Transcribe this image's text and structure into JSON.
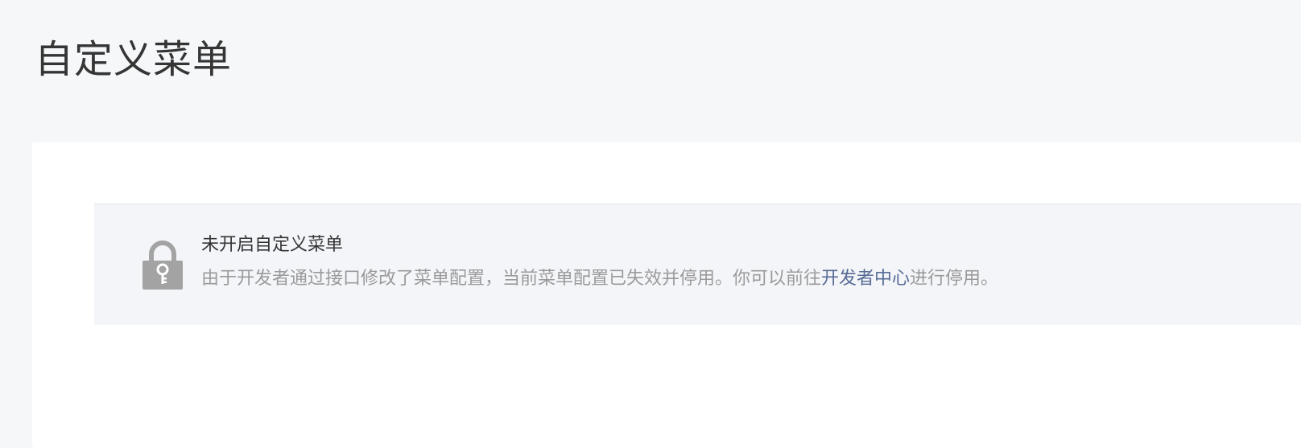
{
  "page": {
    "title": "自定义菜单"
  },
  "notice": {
    "icon": "lock-icon",
    "title": "未开启自定义菜单",
    "desc_before": "由于开发者通过接口修改了菜单配置，当前菜单配置已失效并停用。你可以前往",
    "link_label": "开发者中心",
    "desc_after": "进行停用。"
  },
  "colors": {
    "page_background": "#f6f7f9",
    "card_background": "#ffffff",
    "notice_background": "#f4f5f9",
    "link": "#576b95",
    "icon": "#a3a3a3"
  }
}
